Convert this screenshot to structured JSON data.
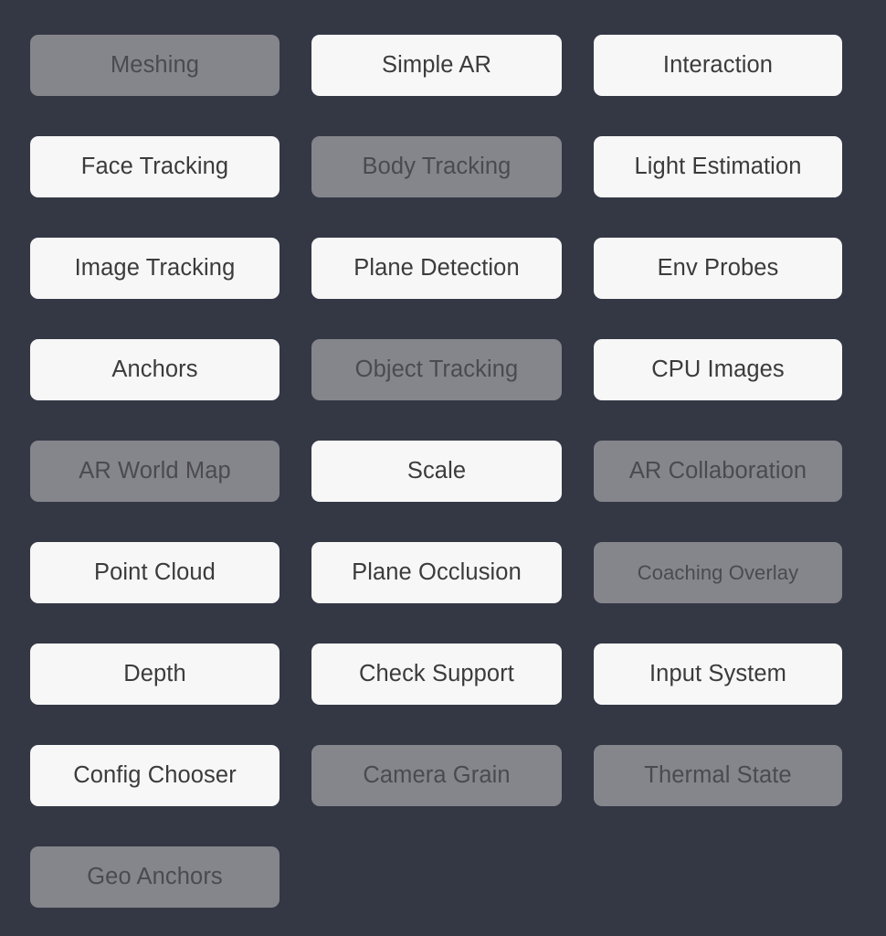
{
  "theme": {
    "background_color": "#343845",
    "button_enabled_bg": "#f7f7f7",
    "button_enabled_text": "#3b3b3b",
    "button_disabled_bg": "#85858c",
    "button_disabled_text": "#4a4a50"
  },
  "menu": {
    "columns": 3,
    "buttons": [
      {
        "label": "Meshing",
        "state": "disabled",
        "row": 1,
        "column": 1
      },
      {
        "label": "Simple AR",
        "state": "enabled",
        "row": 1,
        "column": 2
      },
      {
        "label": "Interaction",
        "state": "enabled",
        "row": 1,
        "column": 3
      },
      {
        "label": "Face Tracking",
        "state": "enabled",
        "row": 2,
        "column": 1
      },
      {
        "label": "Body Tracking",
        "state": "disabled",
        "row": 2,
        "column": 2
      },
      {
        "label": "Light Estimation",
        "state": "enabled",
        "row": 2,
        "column": 3
      },
      {
        "label": "Image Tracking",
        "state": "enabled",
        "row": 3,
        "column": 1
      },
      {
        "label": "Plane Detection",
        "state": "enabled",
        "row": 3,
        "column": 2
      },
      {
        "label": "Env Probes",
        "state": "enabled",
        "row": 3,
        "column": 3
      },
      {
        "label": "Anchors",
        "state": "enabled",
        "row": 4,
        "column": 1
      },
      {
        "label": "Object Tracking",
        "state": "disabled",
        "row": 4,
        "column": 2
      },
      {
        "label": "CPU Images",
        "state": "enabled",
        "row": 4,
        "column": 3
      },
      {
        "label": "AR World Map",
        "state": "disabled",
        "row": 5,
        "column": 1
      },
      {
        "label": "Scale",
        "state": "enabled",
        "row": 5,
        "column": 2
      },
      {
        "label": "AR Collaboration",
        "state": "disabled",
        "row": 5,
        "column": 3
      },
      {
        "label": "Point Cloud",
        "state": "enabled",
        "row": 6,
        "column": 1
      },
      {
        "label": "Plane Occlusion",
        "state": "enabled",
        "row": 6,
        "column": 2
      },
      {
        "label": "Coaching Overlay",
        "state": "disabled",
        "row": 6,
        "column": 3,
        "small": true
      },
      {
        "label": "Depth",
        "state": "enabled",
        "row": 7,
        "column": 1
      },
      {
        "label": "Check Support",
        "state": "enabled",
        "row": 7,
        "column": 2
      },
      {
        "label": "Input System",
        "state": "enabled",
        "row": 7,
        "column": 3
      },
      {
        "label": "Config Chooser",
        "state": "enabled",
        "row": 8,
        "column": 1
      },
      {
        "label": "Camera Grain",
        "state": "disabled",
        "row": 8,
        "column": 2
      },
      {
        "label": "Thermal State",
        "state": "disabled",
        "row": 8,
        "column": 3
      },
      {
        "label": "Geo Anchors",
        "state": "disabled",
        "row": 9,
        "column": 1
      }
    ]
  }
}
